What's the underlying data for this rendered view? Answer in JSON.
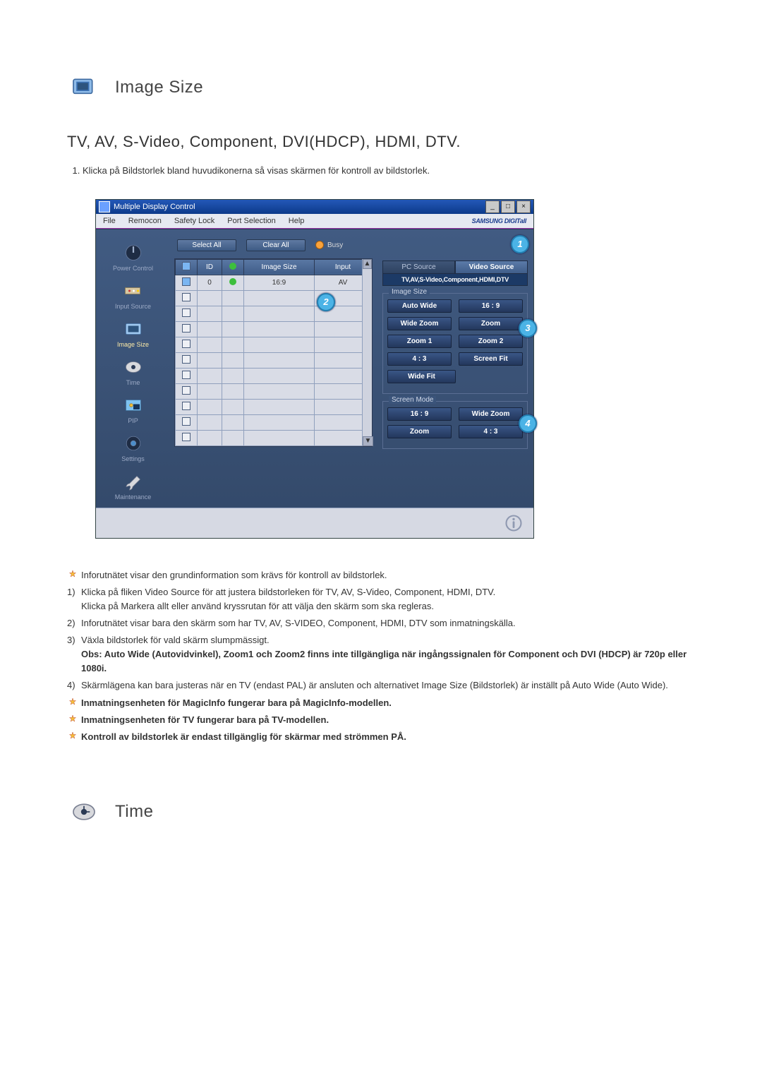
{
  "section1": {
    "title": "Image Size",
    "subheading": "TV, AV, S-Video, Component, DVI(HDCP), HDMI, DTV.",
    "intro_item": "Klicka på Bildstorlek bland huvudikonerna så visas skärmen för kontroll av bildstorlek."
  },
  "app": {
    "window_title": "Multiple Display Control",
    "menus": [
      "File",
      "Remocon",
      "Safety Lock",
      "Port Selection",
      "Help"
    ],
    "branding": "SAMSUNG DIGITall",
    "select_all": "Select All",
    "clear_all": "Clear All",
    "busy": "Busy",
    "leftnav": [
      {
        "name": "power-control",
        "label": "Power Control"
      },
      {
        "name": "input-source",
        "label": "Input Source"
      },
      {
        "name": "image-size",
        "label": "Image Size",
        "active": true
      },
      {
        "name": "time",
        "label": "Time"
      },
      {
        "name": "pip",
        "label": "PIP"
      },
      {
        "name": "settings",
        "label": "Settings"
      },
      {
        "name": "maintenance",
        "label": "Maintenance"
      }
    ],
    "grid": {
      "headers": [
        "",
        "ID",
        "",
        "Image Size",
        "Input"
      ],
      "rows": [
        {
          "checked": true,
          "id": "0",
          "status": "green",
          "image_size": "16:9",
          "input": "AV"
        }
      ],
      "empty_rows": 10
    },
    "right": {
      "tabs": {
        "pc": "PC Source",
        "video": "Video Source"
      },
      "src_line": "TV,AV,S-Video,Component,HDMI,DTV",
      "group1": {
        "legend": "Image Size",
        "buttons": [
          [
            "Auto Wide",
            "16 : 9"
          ],
          [
            "Wide Zoom",
            "Zoom"
          ],
          [
            "Zoom 1",
            "Zoom 2"
          ],
          [
            "4 : 3",
            "Screen Fit"
          ],
          [
            "Wide Fit",
            ""
          ]
        ]
      },
      "group2": {
        "legend": "Screen Mode",
        "buttons": [
          [
            "16 : 9",
            "Wide Zoom"
          ],
          [
            "Zoom",
            "4 : 3"
          ]
        ]
      }
    },
    "callouts": {
      "c1": "1",
      "c2": "2",
      "c3": "3",
      "c4": "4"
    }
  },
  "notes": {
    "star1": "Inforutnätet visar den grundinformation som krävs för kontroll av bildstorlek.",
    "n1a": "Klicka på fliken Video Source för att justera bildstorleken för TV, AV, S-Video, Component, HDMI, DTV.",
    "n1b": "Klicka på Markera allt eller använd kryssrutan för att välja den skärm som ska regleras.",
    "n2": "Inforutnätet visar bara den skärm som har TV, AV, S-VIDEO, Component, HDMI, DTV som inmatningskälla.",
    "n3a": "Växla bildstorlek för vald skärm slumpmässigt.",
    "n3b": "Obs: Auto Wide (Autovidvinkel), Zoom1 och Zoom2 finns inte tillgängliga när ingångssignalen för Component och DVI (HDCP) är 720p eller 1080i.",
    "n4": "Skärmlägena kan bara justeras när en TV (endast PAL) är ansluten och alternativet Image Size (Bildstorlek) är inställt på Auto Wide (Auto Wide).",
    "star2": "Inmatningsenheten för MagicInfo fungerar bara på MagicInfo-modellen.",
    "star3": "Inmatningsenheten för TV fungerar bara på TV-modellen.",
    "star4": "Kontroll av bildstorlek är endast tillgänglig för skärmar med strömmen PÅ."
  },
  "section2": {
    "title": "Time"
  }
}
